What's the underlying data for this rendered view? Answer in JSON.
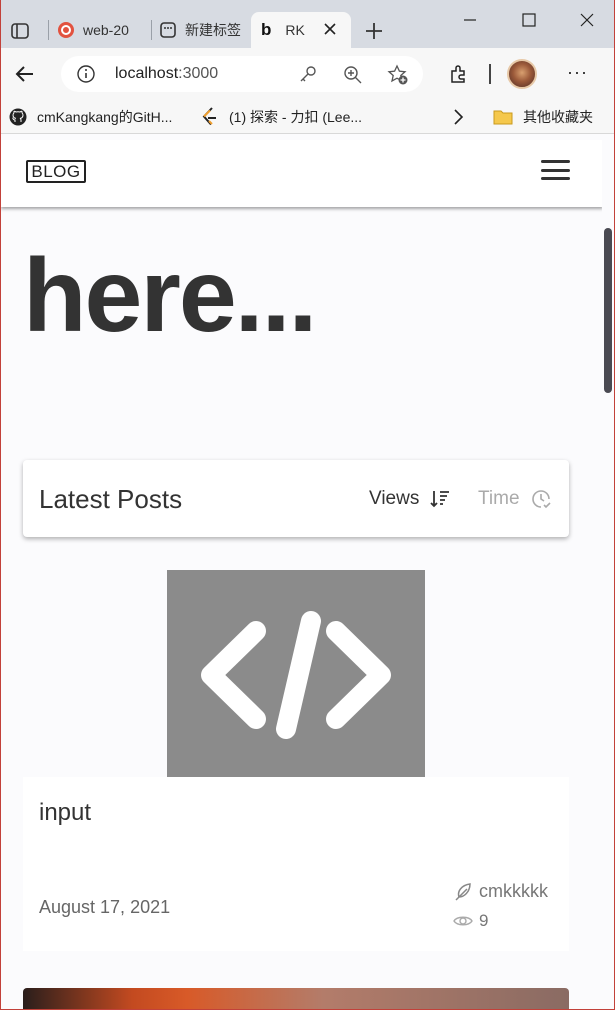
{
  "browser": {
    "tabs": [
      {
        "label": "web-20"
      },
      {
        "label": "新建标签"
      },
      {
        "label": "RK"
      }
    ],
    "address": {
      "host": "localhost",
      "port": ":3000"
    },
    "bookmarks": [
      {
        "label": "cmKangkang的GitH..."
      },
      {
        "label": "(1) 探索 - 力扣 (Lee..."
      },
      {
        "label": "其他收藏夹"
      }
    ],
    "more_label": "···"
  },
  "site": {
    "logo_text": "BLOG",
    "hero_text": "here...",
    "latest": {
      "title": "Latest Posts",
      "sort_views_label": "Views",
      "sort_time_label": "Time"
    },
    "posts": [
      {
        "title": "input",
        "date": "August 17, 2021",
        "author": "cmkkkkk",
        "views": "9"
      }
    ]
  },
  "colors": {
    "accent_red": "#c2413a",
    "thumb_gray": "#8b8b8b",
    "text_dark": "#333333"
  },
  "icons": [
    "tab-actions-icon",
    "site-favicon",
    "close-icon",
    "new-tab-icon",
    "back-icon",
    "info-icon",
    "key-icon",
    "zoom-icon",
    "favorite-add-icon",
    "extensions-icon",
    "github-icon",
    "leetcode-icon",
    "folder-icon",
    "chevron-right-icon",
    "menu-icon",
    "sort-icon",
    "clock-check-icon",
    "code-icon",
    "feather-icon",
    "eye-icon"
  ]
}
